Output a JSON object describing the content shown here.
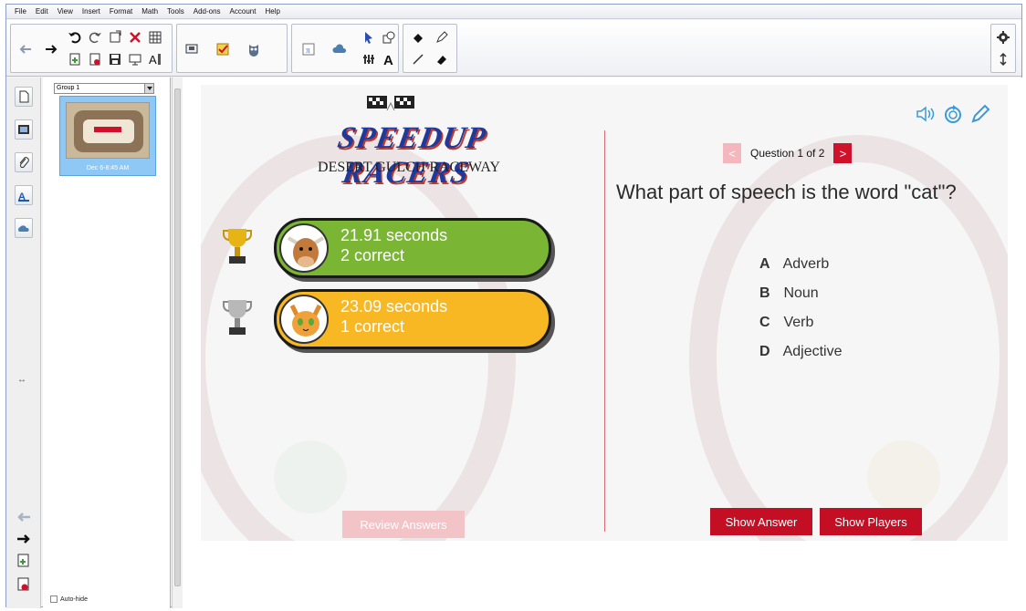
{
  "menubar": {
    "items": [
      "File",
      "Edit",
      "View",
      "Insert",
      "Format",
      "Math",
      "Tools",
      "Add-ons",
      "Account",
      "Help"
    ]
  },
  "toolbar": {
    "icons": [
      "back-arrow-icon",
      "forward-arrow-icon",
      "undo-icon",
      "redo-icon",
      "new-page-icon",
      "delete-icon",
      "table-icon",
      "insert-page-icon",
      "save-icon",
      "screen-icon",
      "text-tool-icon",
      "present-icon",
      "checklist-icon",
      "owl-icon",
      "math-icon",
      "cloud-icon",
      "pointer-icon",
      "shape-icon",
      "fill-icon",
      "pen-icon",
      "equalizer-icon",
      "text-icon",
      "line-icon",
      "eraser-icon",
      "settings-icon",
      "expand-icon"
    ]
  },
  "group_panel": {
    "selected_group": "Group 1",
    "thumbnail_time": "Dec 6-8:45 AM",
    "autohide_label": "Auto-hide"
  },
  "slide": {
    "logo": {
      "title": "SPEEDUP RACERS",
      "subtitle": "DESERT GULCH RACEWAY"
    },
    "results": [
      {
        "time": "21.91 seconds",
        "correct": "2 correct",
        "color": "#7ab534",
        "avatar": "bull-avatar-icon",
        "trophy": "gold-trophy-icon"
      },
      {
        "time": "23.09 seconds",
        "correct": "1 correct",
        "color": "#f7b823",
        "avatar": "cat-avatar-icon",
        "trophy": "silver-trophy-icon"
      }
    ],
    "review_button": "Review Answers",
    "question_nav": {
      "prev": "<",
      "label": "Question 1 of 2",
      "next": ">"
    },
    "question": "What part of speech is the word \"cat\"?",
    "answers": [
      {
        "letter": "A",
        "text": "Adverb"
      },
      {
        "letter": "B",
        "text": "Noun"
      },
      {
        "letter": "C",
        "text": "Verb"
      },
      {
        "letter": "D",
        "text": "Adjective"
      }
    ],
    "show_answer_button": "Show Answer",
    "show_players_button": "Show Players",
    "accent_color": "#c40e23"
  }
}
